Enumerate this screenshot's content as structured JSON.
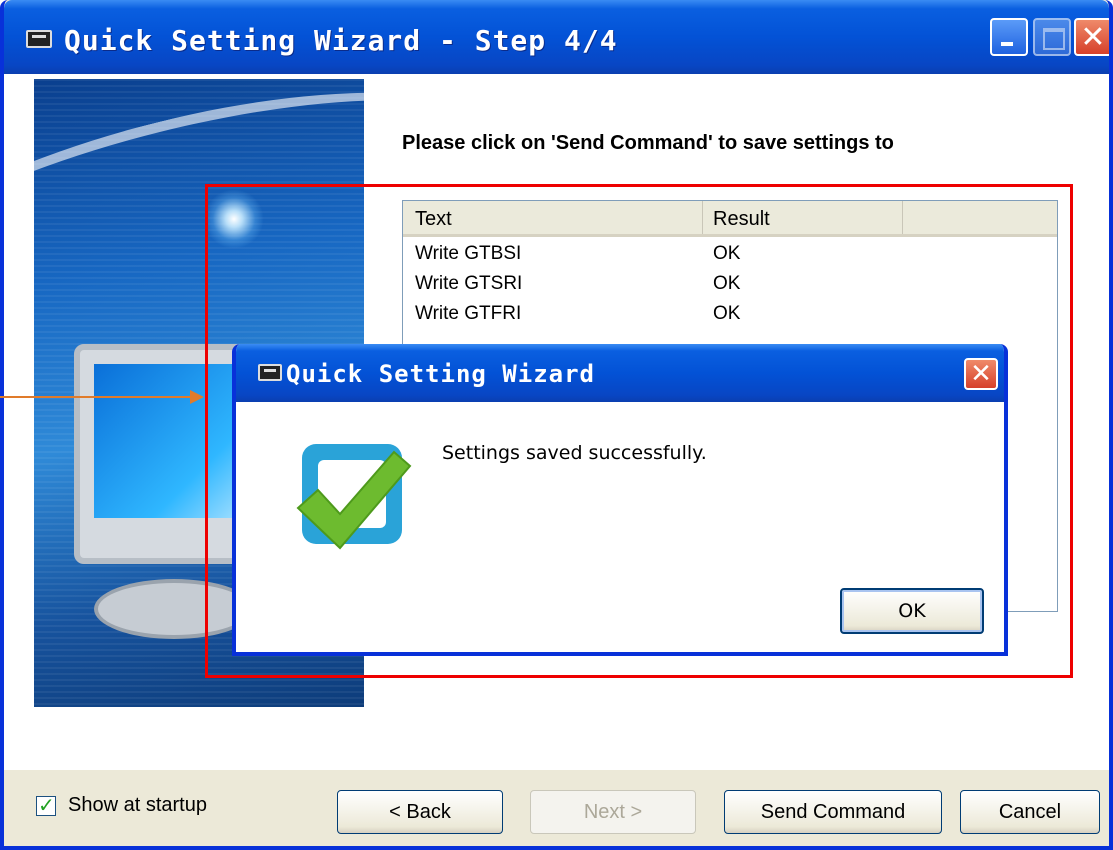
{
  "window": {
    "title": "Quick Setting Wizard - Step 4/4"
  },
  "main": {
    "prompt": "Please click on 'Send Command' to save settings to",
    "list": {
      "columns": [
        "Text",
        "Result"
      ],
      "rows": [
        {
          "text": "Write GTBSI",
          "result": "OK"
        },
        {
          "text": "Write GTSRI",
          "result": "OK"
        },
        {
          "text": "Write GTFRI",
          "result": "OK"
        }
      ]
    }
  },
  "footer": {
    "show_at_startup_label": "Show at startup",
    "show_at_startup_checked": true,
    "back_label": "< Back",
    "next_label": "Next >",
    "send_label": "Send Command",
    "cancel_label": "Cancel"
  },
  "dialog": {
    "title": "Quick Setting Wizard",
    "message": "Settings saved successfully.",
    "ok_label": "OK",
    "icon": "success-checkmark-icon"
  },
  "colors": {
    "titlebar": "#0352d6",
    "highlight": "#ee0000",
    "annotation_arrow": "#e07b2a",
    "check_green": "#6dbb2f",
    "check_box_blue": "#2aa3d8"
  }
}
